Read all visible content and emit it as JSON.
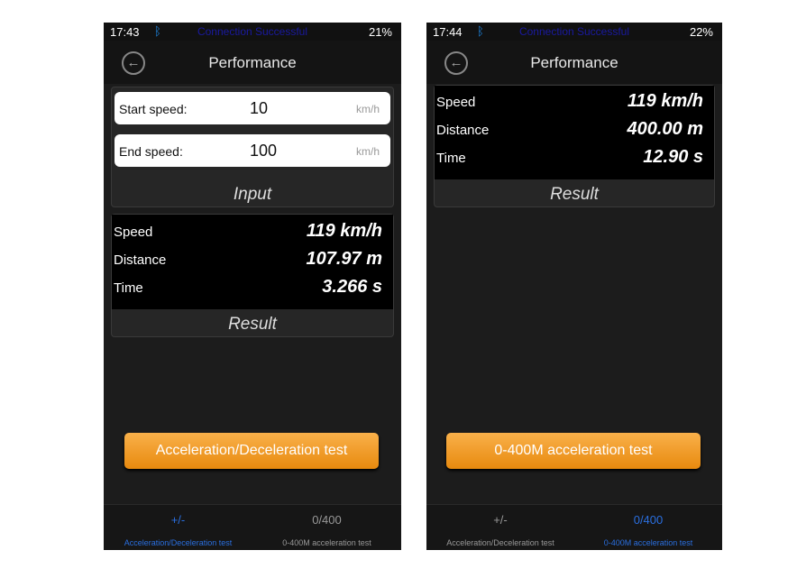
{
  "screens": [
    {
      "time": "17:43",
      "connection": "Connection Successful",
      "battery": "21%",
      "title": "Performance",
      "input": {
        "start_label": "Start speed:",
        "start_value": "10",
        "start_unit": "km/h",
        "end_label": "End speed:",
        "end_value": "100",
        "end_unit": "km/h",
        "caption": "Input"
      },
      "result": {
        "rows": [
          {
            "label": "Speed",
            "value": "119 km/h"
          },
          {
            "label": "Distance",
            "value": "107.97 m"
          },
          {
            "label": "Time",
            "value": "3.266 s"
          }
        ],
        "caption": "Result"
      },
      "button": "Acceleration/Deceleration test"
    },
    {
      "time": "17:44",
      "connection": "Connection Successful",
      "battery": "22%",
      "title": "Performance",
      "result": {
        "rows": [
          {
            "label": "Speed",
            "value": "119 km/h"
          },
          {
            "label": "Distance",
            "value": "400.00 m"
          },
          {
            "label": "Time",
            "value": "12.90 s"
          }
        ],
        "caption": "Result"
      },
      "button": "0-400M acceleration test"
    }
  ],
  "tabs": [
    {
      "icon": "+/-",
      "label": "Acceleration/Deceleration test"
    },
    {
      "icon": "0/400",
      "label": "0-400M acceleration test"
    }
  ],
  "colors": {
    "accent": "#f0a030",
    "active_tab": "#2a6fe0",
    "background": "#1c1c1c"
  }
}
